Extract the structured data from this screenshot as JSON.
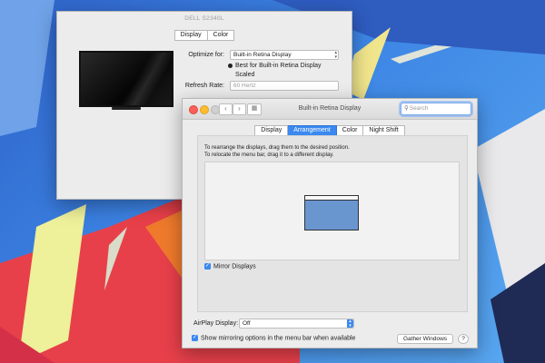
{
  "colors": {
    "accent": "#3b89f0",
    "desktop_blue": "#3d86e5",
    "desktop_red": "#e8404a",
    "desktop_orange": "#f07a2c",
    "desktop_yellow": "#eef09a"
  },
  "back_window": {
    "title": "DELL S2340L",
    "tabs": [
      "Display",
      "Color"
    ],
    "active_tab": "Display",
    "optimize_label": "Optimize for:",
    "optimize_value": "Built-in Retina Display",
    "radio_best": "Best for Built-in Retina Display",
    "radio_scaled": "Scaled",
    "refresh_label": "Refresh Rate:",
    "refresh_value": "60 Hertz"
  },
  "front_window": {
    "title": "Built-in Retina Display",
    "search_placeholder": "Search",
    "tabs": [
      "Display",
      "Arrangement",
      "Color",
      "Night Shift"
    ],
    "active_tab": "Arrangement",
    "instruction_1": "To rearrange the displays, drag them to the desired position.",
    "instruction_2": "To relocate the menu bar, drag it to a different display.",
    "mirror_label": "Mirror Displays",
    "mirror_checked": true,
    "airplay_label": "AirPlay Display:",
    "airplay_value": "Off",
    "show_mirroring_label": "Show mirroring options in the menu bar when available",
    "show_mirroring_checked": true,
    "gather_button": "Gather Windows",
    "help_button": "?"
  },
  "icons": {
    "back": "chevron-left",
    "forward": "chevron-right",
    "grid": "grid",
    "search": "magnifier"
  }
}
